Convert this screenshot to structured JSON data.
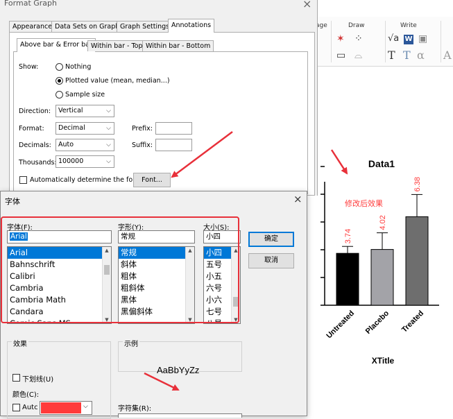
{
  "colors": {
    "annotation_red": "#e8303a",
    "accent": "#0078d7",
    "font_color": "#ff3a3a"
  },
  "ribbon": {
    "group_page": "age",
    "group_draw": "Draw",
    "group_write": "Write",
    "draw_icons": [
      "star-marker-icon",
      "marker-dropdown-icon",
      "rectangle-icon",
      "line-style-icon"
    ],
    "write_icons": [
      "sqrt-a-icon",
      "word-icon",
      "text-t-icon",
      "text-t-outline-icon",
      "alpha-icon",
      "font-a-icon"
    ]
  },
  "graph": {
    "chart_data": {
      "type": "bar",
      "title": "Data1",
      "xlabel": "XTitle",
      "categories": [
        "Untreated",
        "Placebo",
        "Treated"
      ],
      "values": [
        3.74,
        4.02,
        6.38
      ],
      "errors": [
        0.5,
        1.2,
        1.6
      ],
      "bar_colors": [
        "#000000",
        "#a3a3a8",
        "#6e6e6e"
      ],
      "data_labels": [
        "3.74",
        "4.02",
        "6.38"
      ],
      "ylim": [
        0,
        10
      ],
      "annotation": "修改后效果"
    }
  },
  "format_graph": {
    "title": "Format Graph",
    "close": "×",
    "tabs": [
      "Appearance",
      "Data Sets on Graph",
      "Graph Settings",
      "Annotations"
    ],
    "active_tab": "Annotations",
    "subtabs": [
      "Above bar & Error bar",
      "Within bar - Top",
      "Within bar - Bottom"
    ],
    "show_label": "Show:",
    "radio_options": [
      "Nothing",
      "Plotted value (mean, median...)",
      "Sample size"
    ],
    "selected_radio": "Plotted value (mean, median...)",
    "direction_label": "Direction:",
    "direction_value": "Vertical",
    "format_label": "Format:",
    "format_value": "Decimal",
    "decimals_label": "Decimals:",
    "decimals_value": "Auto",
    "thousands_label": "Thousands:",
    "thousands_value": "100000",
    "prefix_label": "Prefix:",
    "suffix_label": "Suffix:",
    "auto_font_label": "Automatically determine the font",
    "font_button": "Font..."
  },
  "font_dialog": {
    "title": "字体",
    "close": "×",
    "font_label": "字体(F):",
    "font_value": "Arial",
    "font_list": [
      "Arial",
      "Bahnschrift",
      "Calibri",
      "Cambria",
      "Cambria Math",
      "Candara",
      "Comic Sans MS"
    ],
    "style_label": "字形(Y):",
    "style_value": "常规",
    "style_list": [
      "常规",
      "斜体",
      "粗体",
      "粗斜体",
      "黑体",
      "黑偏斜体"
    ],
    "size_label": "大小(S):",
    "size_value": "小四",
    "size_list": [
      "小四",
      "五号",
      "小五",
      "六号",
      "小六",
      "七号",
      "八号"
    ],
    "ok": "确定",
    "cancel": "取消",
    "effects_label": "效果",
    "underline_label": "下划线(U)",
    "color_label": "颜色(C):",
    "auto_label": "Autc",
    "sample_label": "示例",
    "sample_text": "AaBbYyZz",
    "charset_label": "字符集(R):"
  }
}
